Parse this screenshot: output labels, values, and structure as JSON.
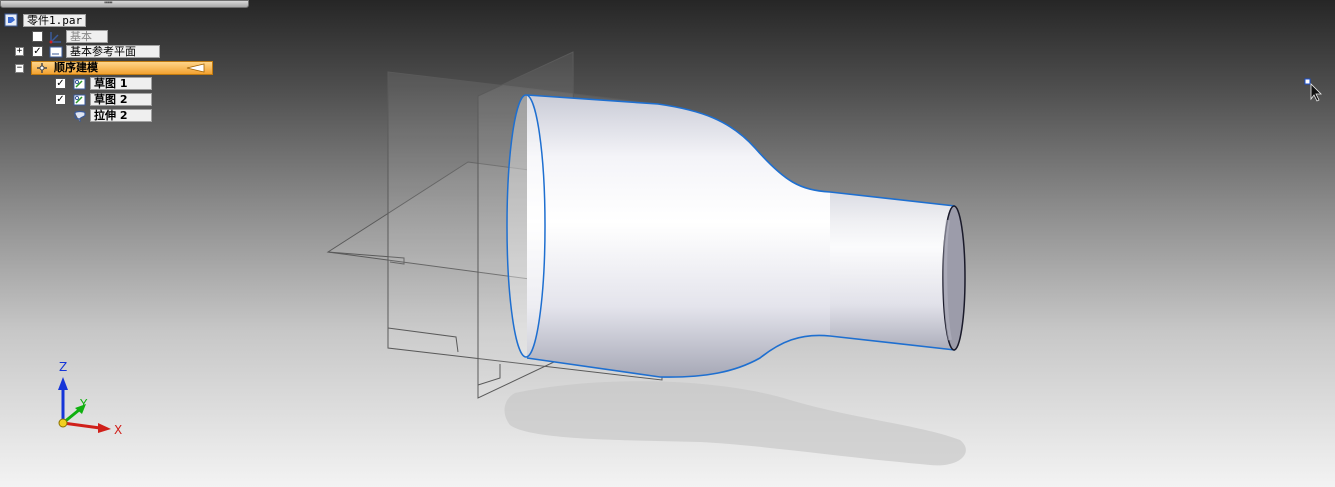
{
  "pathfinder": {
    "root": {
      "label": "零件1.par",
      "icon": "part-file-icon"
    },
    "items": [
      {
        "label": "基本",
        "checked": false,
        "expandable": false,
        "icon": "coordinate-system-icon"
      },
      {
        "label": "基本参考平面",
        "checked": true,
        "expander": "+",
        "icon": "reference-plane-icon"
      },
      {
        "label": "顺序建模",
        "expander": "−",
        "icon": "ordered-modeling-icon",
        "highlighted": true
      },
      {
        "label": "草图 1",
        "checked": true,
        "icon": "sketch-icon"
      },
      {
        "label": "草图 2",
        "checked": true,
        "icon": "sketch-icon"
      },
      {
        "label": "拉伸 2",
        "icon": "extrude-icon"
      }
    ]
  },
  "triad": {
    "x_label": "X",
    "y_label": "Y",
    "z_label": "Z",
    "x_color": "#d0201a",
    "y_color": "#10b010",
    "z_color": "#1535d8"
  },
  "colors": {
    "selection_highlight": "#f3a230",
    "edge_highlight": "#1e6fd0"
  }
}
